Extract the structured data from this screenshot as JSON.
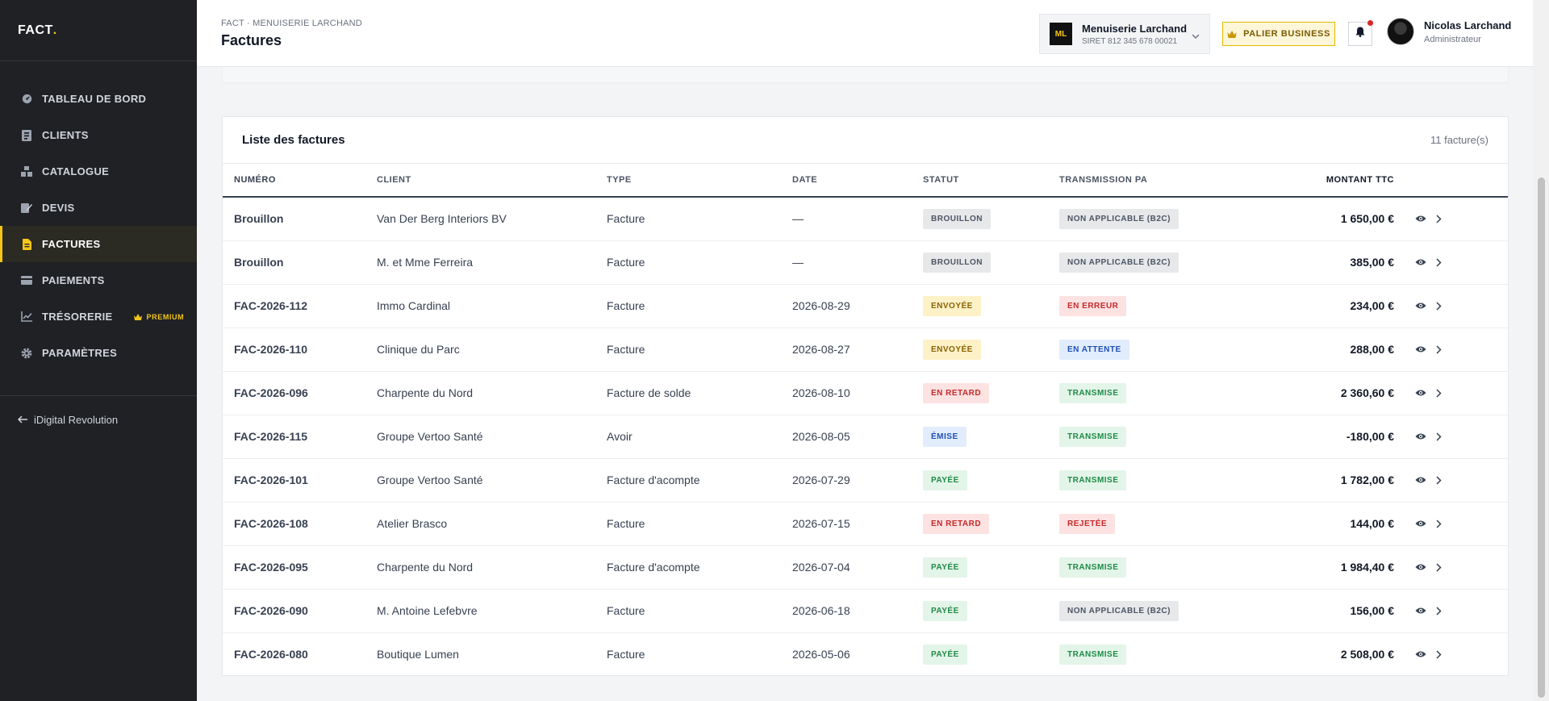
{
  "sidebar": {
    "logo": {
      "text": "FACT",
      "dot": "."
    },
    "items": [
      {
        "label": "TABLEAU DE BORD",
        "icon": "dashboard-icon",
        "active": false
      },
      {
        "label": "CLIENTS",
        "icon": "clients-icon",
        "active": false
      },
      {
        "label": "CATALOGUE",
        "icon": "catalog-icon",
        "active": false
      },
      {
        "label": "DEVIS",
        "icon": "quote-icon",
        "active": false
      },
      {
        "label": "FACTURES",
        "icon": "invoice-icon",
        "active": true
      },
      {
        "label": "PAIEMENTS",
        "icon": "card-icon",
        "active": false
      },
      {
        "label": "TRÉSORERIE",
        "icon": "chart-icon",
        "active": false,
        "badge": "PREMIUM"
      },
      {
        "label": "PARAMÈTRES",
        "icon": "gear-icon",
        "active": false
      }
    ],
    "back_label": "iDigital Revolution"
  },
  "header": {
    "breadcrumb": "FACT · MENUISERIE LARCHAND",
    "title": "Factures",
    "company": {
      "initials": "ML",
      "name": "Menuiserie Larchand",
      "siret": "SIRET 812 345 678 00021"
    },
    "plan_label": "PALIER BUSINESS",
    "user": {
      "name": "Nicolas Larchand",
      "role": "Administrateur"
    }
  },
  "invoices": {
    "title": "Liste des factures",
    "count": "11 facture(s)",
    "columns": {
      "number": "NUMÉRO",
      "client": "CLIENT",
      "type": "TYPE",
      "date": "DATE",
      "status": "STATUT",
      "transmission": "TRANSMISSION PA",
      "amount": "MONTANT TTC"
    },
    "rows": [
      {
        "number": "Brouillon",
        "client": "Van Der Berg Interiors BV",
        "type": "Facture",
        "date": "—",
        "status": "BROUILLON",
        "status_tone": "grey",
        "transmission": "NON APPLICABLE (B2C)",
        "transmission_tone": "grey",
        "amount": "1 650,00 €"
      },
      {
        "number": "Brouillon",
        "client": "M. et Mme Ferreira",
        "type": "Facture",
        "date": "—",
        "status": "BROUILLON",
        "status_tone": "grey",
        "transmission": "NON APPLICABLE (B2C)",
        "transmission_tone": "grey",
        "amount": "385,00 €"
      },
      {
        "number": "FAC-2026-112",
        "client": "Immo Cardinal",
        "type": "Facture",
        "date": "2026-08-29",
        "status": "ENVOYÉE",
        "status_tone": "yellow",
        "transmission": "EN ERREUR",
        "transmission_tone": "red",
        "amount": "234,00 €"
      },
      {
        "number": "FAC-2026-110",
        "client": "Clinique du Parc",
        "type": "Facture",
        "date": "2026-08-27",
        "status": "ENVOYÉE",
        "status_tone": "yellow",
        "transmission": "EN ATTENTE",
        "transmission_tone": "blue",
        "amount": "288,00 €"
      },
      {
        "number": "FAC-2026-096",
        "client": "Charpente du Nord",
        "type": "Facture de solde",
        "date": "2026-08-10",
        "status": "EN RETARD",
        "status_tone": "red",
        "transmission": "TRANSMISE",
        "transmission_tone": "green",
        "amount": "2 360,60 €"
      },
      {
        "number": "FAC-2026-115",
        "client": "Groupe Vertoo Santé",
        "type": "Avoir",
        "date": "2026-08-05",
        "status": "ÉMISE",
        "status_tone": "blue",
        "transmission": "TRANSMISE",
        "transmission_tone": "green",
        "amount": "-180,00 €"
      },
      {
        "number": "FAC-2026-101",
        "client": "Groupe Vertoo Santé",
        "type": "Facture d'acompte",
        "date": "2026-07-29",
        "status": "PAYÉE",
        "status_tone": "green",
        "transmission": "TRANSMISE",
        "transmission_tone": "green",
        "amount": "1 782,00 €"
      },
      {
        "number": "FAC-2026-108",
        "client": "Atelier Brasco",
        "type": "Facture",
        "date": "2026-07-15",
        "status": "EN RETARD",
        "status_tone": "red",
        "transmission": "REJETÉE",
        "transmission_tone": "red",
        "amount": "144,00 €"
      },
      {
        "number": "FAC-2026-095",
        "client": "Charpente du Nord",
        "type": "Facture d'acompte",
        "date": "2026-07-04",
        "status": "PAYÉE",
        "status_tone": "green",
        "transmission": "TRANSMISE",
        "transmission_tone": "green",
        "amount": "1 984,40 €"
      },
      {
        "number": "FAC-2026-090",
        "client": "M. Antoine Lefebvre",
        "type": "Facture",
        "date": "2026-06-18",
        "status": "PAYÉE",
        "status_tone": "green",
        "transmission": "NON APPLICABLE (B2C)",
        "transmission_tone": "grey",
        "amount": "156,00 €"
      },
      {
        "number": "FAC-2026-080",
        "client": "Boutique Lumen",
        "type": "Facture",
        "date": "2026-05-06",
        "status": "PAYÉE",
        "status_tone": "green",
        "transmission": "TRANSMISE",
        "transmission_tone": "green",
        "amount": "2 508,00 €"
      }
    ]
  },
  "colors": {
    "accent": "#f5c518",
    "sidebar_bg": "#1f2125"
  }
}
